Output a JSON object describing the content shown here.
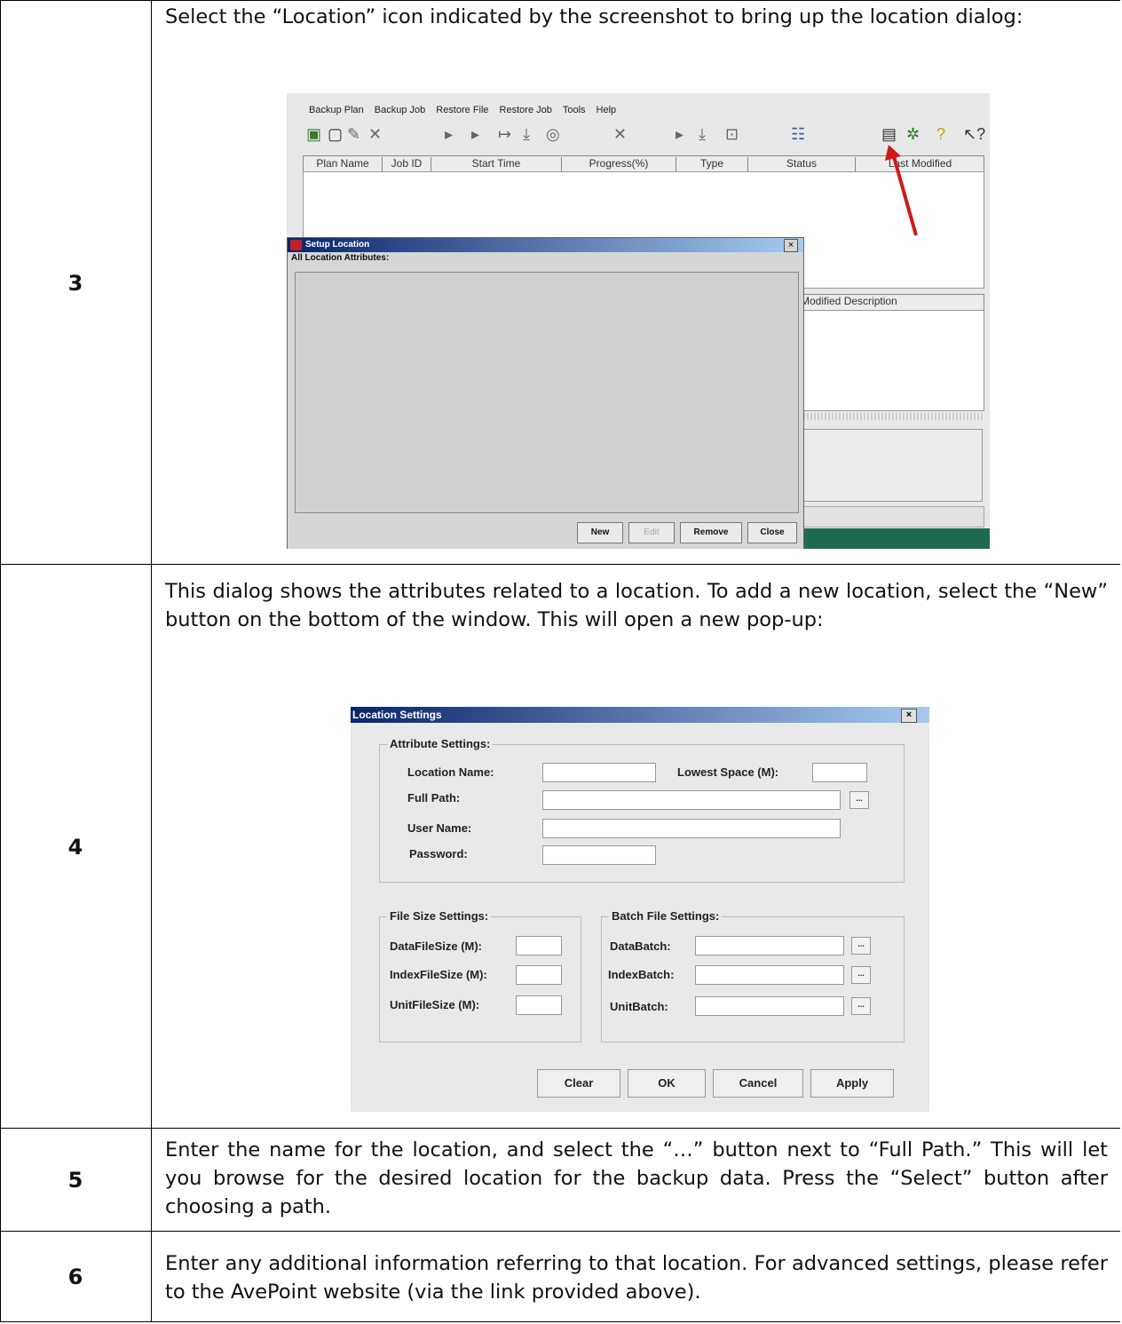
{
  "rows": [
    {
      "num": "3",
      "text": "Select the “Location” icon indicated by the screenshot to bring up the location dialog:"
    },
    {
      "num": "4",
      "text": "This dialog shows the attributes related to a location. To add a new location, select the “New” button on the bottom of the window. This will open a new pop-up:"
    },
    {
      "num": "5",
      "text": "Enter the name for the location, and select the “…” button next to “Full Path.” This will let you browse for the desired location for the backup data. Press the “Select” button after choosing a path."
    },
    {
      "num": "6",
      "text": "Enter any additional information referring to that location. For advanced settings, please refer to the AvePoint website (via the link provided above)."
    }
  ],
  "shot1": {
    "menu": [
      "Backup Plan",
      "Backup Job",
      "Restore File",
      "Restore Job",
      "Tools",
      "Help"
    ],
    "columns": [
      "Plan Name",
      "Job ID",
      "Start Time",
      "Progress(%)",
      "Type",
      "Status",
      "Last Modified"
    ],
    "columns2": [
      "Modified",
      "Description"
    ],
    "dialog": {
      "title": "Setup Location",
      "label": "All Location Attributes:",
      "buttons": [
        "New",
        "Edit",
        "Remove",
        "Close"
      ]
    }
  },
  "shot2": {
    "title": "Location Settings",
    "attribute_legend": "Attribute Settings:",
    "location_name": "Location Name:",
    "lowest_space": "Lowest Space (M):",
    "full_path": "Full Path:",
    "user_name": "User Name:",
    "password": "Password:",
    "file_size_legend": "File Size Settings:",
    "data_file_size": "DataFileSize (M):",
    "index_file_size": "IndexFileSize (M):",
    "unit_file_size": "UnitFileSize (M):",
    "batch_legend": "Batch File Settings:",
    "data_batch": "DataBatch:",
    "index_batch": "IndexBatch:",
    "unit_batch": "UnitBatch:",
    "browse": "...",
    "buttons": {
      "clear": "Clear",
      "ok": "OK",
      "cancel": "Cancel",
      "apply": "Apply"
    }
  }
}
